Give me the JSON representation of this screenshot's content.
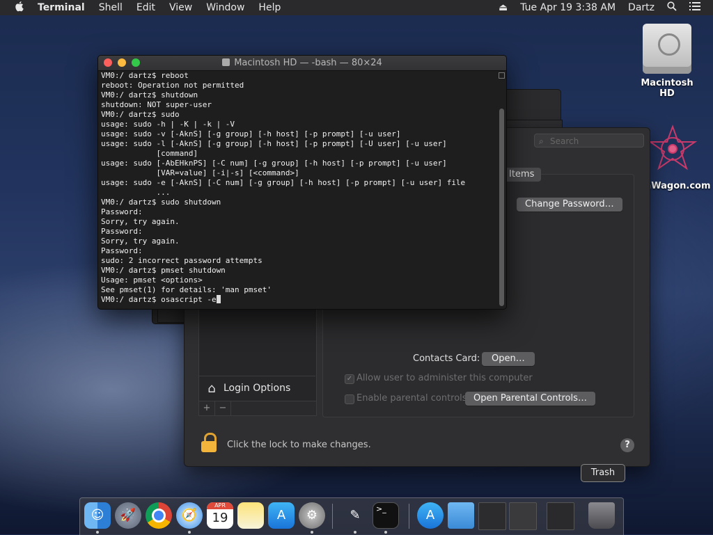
{
  "menubar": {
    "apple_icon": "apple-logo-icon",
    "app_name": "Terminal",
    "menus": [
      "Shell",
      "Edit",
      "View",
      "Window",
      "Help"
    ],
    "clock": "Tue Apr 19  3:38 AM",
    "user": "Dartz"
  },
  "desktop": {
    "drive_label": "Macintosh HD",
    "partial_label": "nWagon.com"
  },
  "terminal": {
    "title": "Macintosh HD — -bash — 80×24",
    "lines": [
      "VM0:/ dartz$ reboot",
      "reboot: Operation not permitted",
      "VM0:/ dartz$ shutdown",
      "shutdown: NOT super-user",
      "VM0:/ dartz$ sudo",
      "usage: sudo -h | -K | -k | -V",
      "usage: sudo -v [-AknS] [-g group] [-h host] [-p prompt] [-u user]",
      "usage: sudo -l [-AknS] [-g group] [-h host] [-p prompt] [-U user] [-u user]",
      "            [command]",
      "usage: sudo [-AbEHknPS] [-C num] [-g group] [-h host] [-p prompt] [-u user]",
      "            [VAR=value] [-i|-s] [<command>]",
      "usage: sudo -e [-AknS] [-C num] [-g group] [-h host] [-p prompt] [-u user] file",
      "            ...",
      "VM0:/ dartz$ sudo shutdown",
      "Password:",
      "Sorry, try again.",
      "Password:",
      "Sorry, try again.",
      "Password:",
      "sudo: 2 incorrect password attempts",
      "VM0:/ dartz$ pmset shutdown",
      "Usage: pmset <options>",
      "See pmset(1) for details: 'man pmset'"
    ],
    "current_prompt": "VM0:/ dartz$ osascript -e"
  },
  "prefs": {
    "search_placeholder": "Search",
    "tab_label": "Items",
    "change_password_button": "Change Password…",
    "contacts_card_label": "Contacts Card:",
    "open_button": "Open…",
    "allow_admin_label": "Allow user to administer this computer",
    "parental_label": "Enable parental controls",
    "open_parental_button": "Open Parental Controls…",
    "login_options": "Login Options",
    "plus": "+",
    "minus": "−",
    "lock_text": "Click the lock to make changes.",
    "help": "?"
  },
  "dock": {
    "tooltip": "Trash",
    "calendar_month": "APR",
    "calendar_day": "19",
    "terminal_glyph": ">_"
  }
}
